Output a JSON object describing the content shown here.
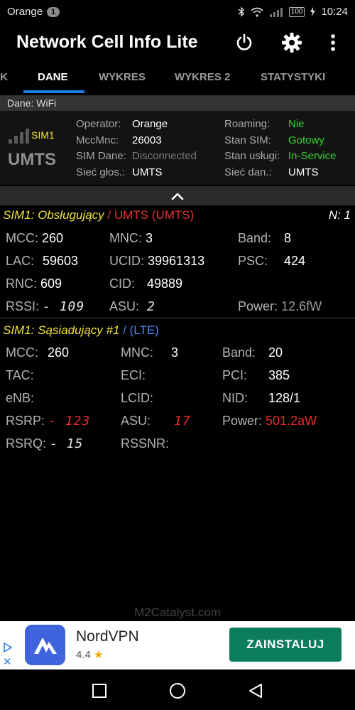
{
  "status_bar": {
    "carrier": "Orange",
    "notification_count": "1",
    "battery": "100",
    "time": "10:24"
  },
  "app_bar": {
    "title": "Network Cell Info Lite",
    "icons": [
      "power-icon",
      "gear-icon",
      "more-vert-icon"
    ]
  },
  "tabs": {
    "items": [
      {
        "label": "IK",
        "active": false
      },
      {
        "label": "DANE",
        "active": true
      },
      {
        "label": "WYKRES",
        "active": false
      },
      {
        "label": "WYKRES 2",
        "active": false
      },
      {
        "label": "STATYSTYKI",
        "active": false
      }
    ]
  },
  "dane_bar": {
    "text": "Dane: WiFi"
  },
  "sim_info": {
    "sim_label": "SIM1",
    "network_type": "UMTS",
    "rows_left": [
      {
        "label": "Operator:",
        "value": "Orange"
      },
      {
        "label": "MccMnc:",
        "value": "26003"
      },
      {
        "label": "SIM Dane:",
        "value": "Disconnected"
      },
      {
        "label": "Sieć głos.:",
        "value": "UMTS"
      }
    ],
    "rows_right": [
      {
        "label": "Roaming:",
        "value": "Nie"
      },
      {
        "label": "Stan SIM:",
        "value": "Gotowy"
      },
      {
        "label": "Stan usługi:",
        "value": "In-Service"
      },
      {
        "label": "Sieć dan.:",
        "value": "UMTS"
      }
    ]
  },
  "serving_cell": {
    "title_prefix": "SIM1: Obsługujący",
    "title_suffix": "/ UMTS (UMTS)",
    "n_label": "N: 1",
    "mcc_label": "MCC:",
    "mcc": "260",
    "mnc_label": "MNC:",
    "mnc": "3",
    "band_label": "Band:",
    "band": "8",
    "lac_label": "LAC:",
    "lac": "59603",
    "ucid_label": "UCID:",
    "ucid": "39961313",
    "psc_label": "PSC:",
    "psc": "424",
    "rnc_label": "RNC:",
    "rnc": "609",
    "cid_label": "CID:",
    "cid": "49889",
    "rssi_label": "RSSI:",
    "rssi": "- 109",
    "asu_label": "ASU:",
    "asu": "2",
    "power_label": "Power:",
    "power": "12.6fW"
  },
  "neighbor_cell": {
    "title_prefix": "SIM1: Sąsiadujący #1",
    "title_suffix": "/ (LTE)",
    "mcc_label": "MCC:",
    "mcc": "260",
    "mnc_label": "MNC:",
    "mnc": "3",
    "band_label": "Band:",
    "band": "20",
    "tac_label": "TAC:",
    "tac": "",
    "eci_label": "ECI:",
    "eci": "",
    "pci_label": "PCI:",
    "pci": "385",
    "enb_label": "eNB:",
    "enb": "",
    "lcid_label": "LCID:",
    "lcid": "",
    "nid_label": "NID:",
    "nid": "128/1",
    "rsrp_label": "RSRP:",
    "rsrp": "- 123",
    "asu_label": "ASU:",
    "asu": "17",
    "power_label": "Power:",
    "power": "501.2aW",
    "rsrq_label": "RSRQ:",
    "rsrq": "- 15",
    "rssnr_label": "RSSNR:",
    "rssnr": ""
  },
  "watermark": "M2Catalyst.com",
  "ad": {
    "name": "NordVPN",
    "rating": "4.4",
    "star": "★",
    "button": "ZAINSTALUJ",
    "close": "✕"
  },
  "colors": {
    "accent": "#1e7fe0",
    "sim_yellow": "#f3e33a",
    "status_green": "#35d435",
    "signal_red": "#f02828",
    "lte_blue": "#4f86ff",
    "install_green": "#0b7d5d"
  }
}
